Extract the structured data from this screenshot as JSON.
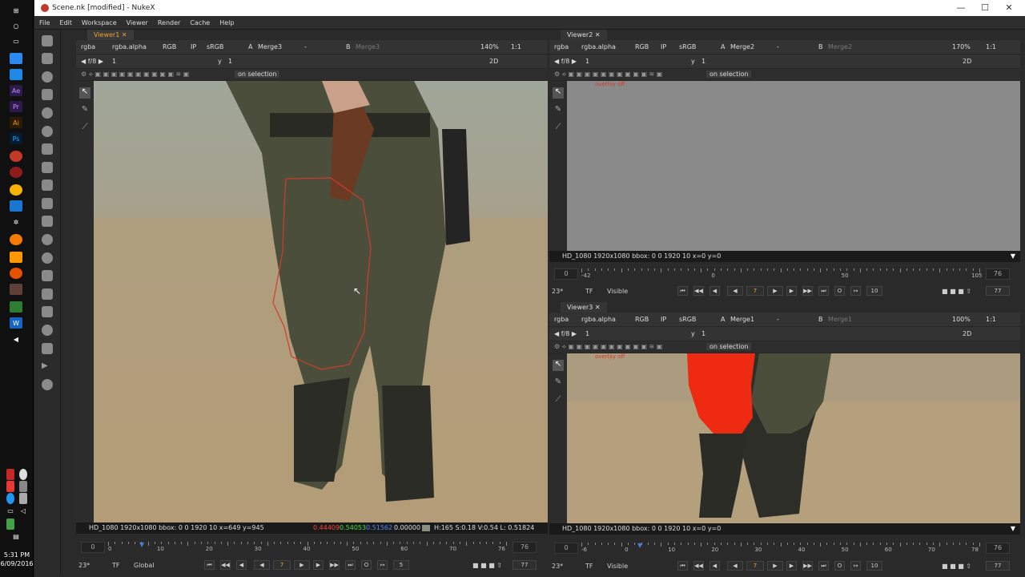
{
  "window": {
    "title": "Scene.nk [modified] - NukeX",
    "min": "—",
    "max": "☐",
    "close": "✕"
  },
  "menu": [
    "File",
    "Edit",
    "Workspace",
    "Viewer",
    "Render",
    "Cache",
    "Help"
  ],
  "taskbar": {
    "time": "5:31 PM",
    "date": "6/09/2016"
  },
  "viewer1": {
    "tab": "Viewer1",
    "channels": "rgba",
    "alpha": "rgba.alpha",
    "colorspace": "RGB",
    "ip": "IP",
    "lut": "sRGB",
    "a_label": "A",
    "a_input": "Merge3",
    "dash": "-",
    "b_label": "B",
    "b_input": "Merge3",
    "zoom": "140%",
    "ratio": "1:1",
    "fstop": "f/8",
    "frame": "1",
    "y_label": "y",
    "y_value": "1",
    "mode": "2D",
    "selection": "on selection",
    "info_left": "HD_1080 1920x1080  bbox: 0 0 1920 10  x=649 y=945",
    "px_r": "0.44409",
    "px_g": "0.54053",
    "px_b": "0.51562",
    "px_a": "0.00000",
    "info_right": "H:165 S:0.18 V:0.54  L: 0.51824",
    "tl_start": "0",
    "tl_end": "76",
    "tl_ticks": [
      "0",
      "10",
      "20",
      "30",
      "40",
      "50",
      "60",
      "70",
      "76"
    ],
    "fps": "23*",
    "tf": "TF",
    "global": "Global",
    "cur_frame": "7",
    "step": "5",
    "end_frame": "77"
  },
  "viewer2": {
    "tab": "Viewer2",
    "channels": "rgba",
    "alpha": "rgba.alpha",
    "colorspace": "RGB",
    "ip": "IP",
    "lut": "sRGB",
    "a_label": "A",
    "a_input": "Merge2",
    "dash": "-",
    "b_label": "B",
    "b_input": "Merge2",
    "zoom": "170%",
    "ratio": "1:1",
    "fstop": "f/8",
    "frame": "1",
    "y_label": "y",
    "y_value": "1",
    "mode": "2D",
    "selection": "on selection",
    "overlay": "overlay off",
    "info_left": "HD_1080 1920x1080  bbox: 0 0 1920 10  x=0 y=0",
    "tl_start": "0",
    "tl_end": "76",
    "tl_ticks": [
      "-42",
      "0",
      "50",
      "105"
    ],
    "fps": "23*",
    "tf": "TF",
    "visible": "Visible",
    "cur_frame": "7",
    "step": "10",
    "end_frame": "77"
  },
  "viewer3": {
    "tab": "Viewer3",
    "channels": "rgba",
    "alpha": "rgba.alpha",
    "colorspace": "RGB",
    "ip": "IP",
    "lut": "sRGB",
    "a_label": "A",
    "a_input": "Merge1",
    "dash": "-",
    "b_label": "B",
    "b_input": "Merge1",
    "zoom": "100%",
    "ratio": "1:1",
    "fstop": "f/8",
    "frame": "1",
    "y_label": "y",
    "y_value": "1",
    "mode": "2D",
    "selection": "on selection",
    "overlay": "overlay off",
    "info_left": "HD_1080 1920x1080  bbox: 0 0 1920 10  x=0 y=0",
    "tl_start": "0",
    "tl_end": "76",
    "tl_ticks": [
      "-6",
      "0",
      "10",
      "20",
      "30",
      "40",
      "50",
      "60",
      "70",
      "78"
    ],
    "fps": "23*",
    "tf": "TF",
    "visible": "Visible",
    "cur_frame": "7",
    "step": "10",
    "end_frame": "77"
  }
}
